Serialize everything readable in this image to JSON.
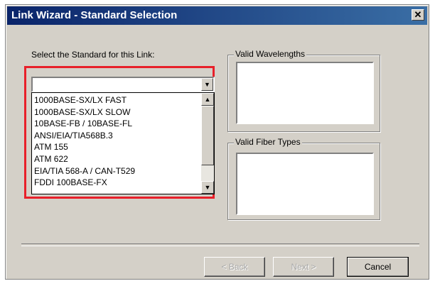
{
  "window": {
    "title": "Link Wizard - Standard Selection",
    "close_glyph": "✕"
  },
  "standard": {
    "prompt": "Select the Standard for this Link:",
    "combo_value": "",
    "options": [
      "1000BASE-SX/LX FAST",
      "1000BASE-SX/LX SLOW",
      "10BASE-FB / 10BASE-FL",
      "ANSI/EIA/TIA568B.3",
      "ATM 155",
      "ATM 622",
      "EIA/TIA 568-A / CAN-T529",
      "FDDI 100BASE-FX"
    ]
  },
  "wavelengths": {
    "label": "Valid Wavelengths"
  },
  "fiber_types": {
    "label": "Valid Fiber Types"
  },
  "buttons": {
    "back": "< Back",
    "next": "Next >",
    "cancel": "Cancel"
  },
  "colors": {
    "highlight": "#e8202a",
    "title_bar": "#0a246a",
    "dialog_bg": "#d4d0c8"
  }
}
